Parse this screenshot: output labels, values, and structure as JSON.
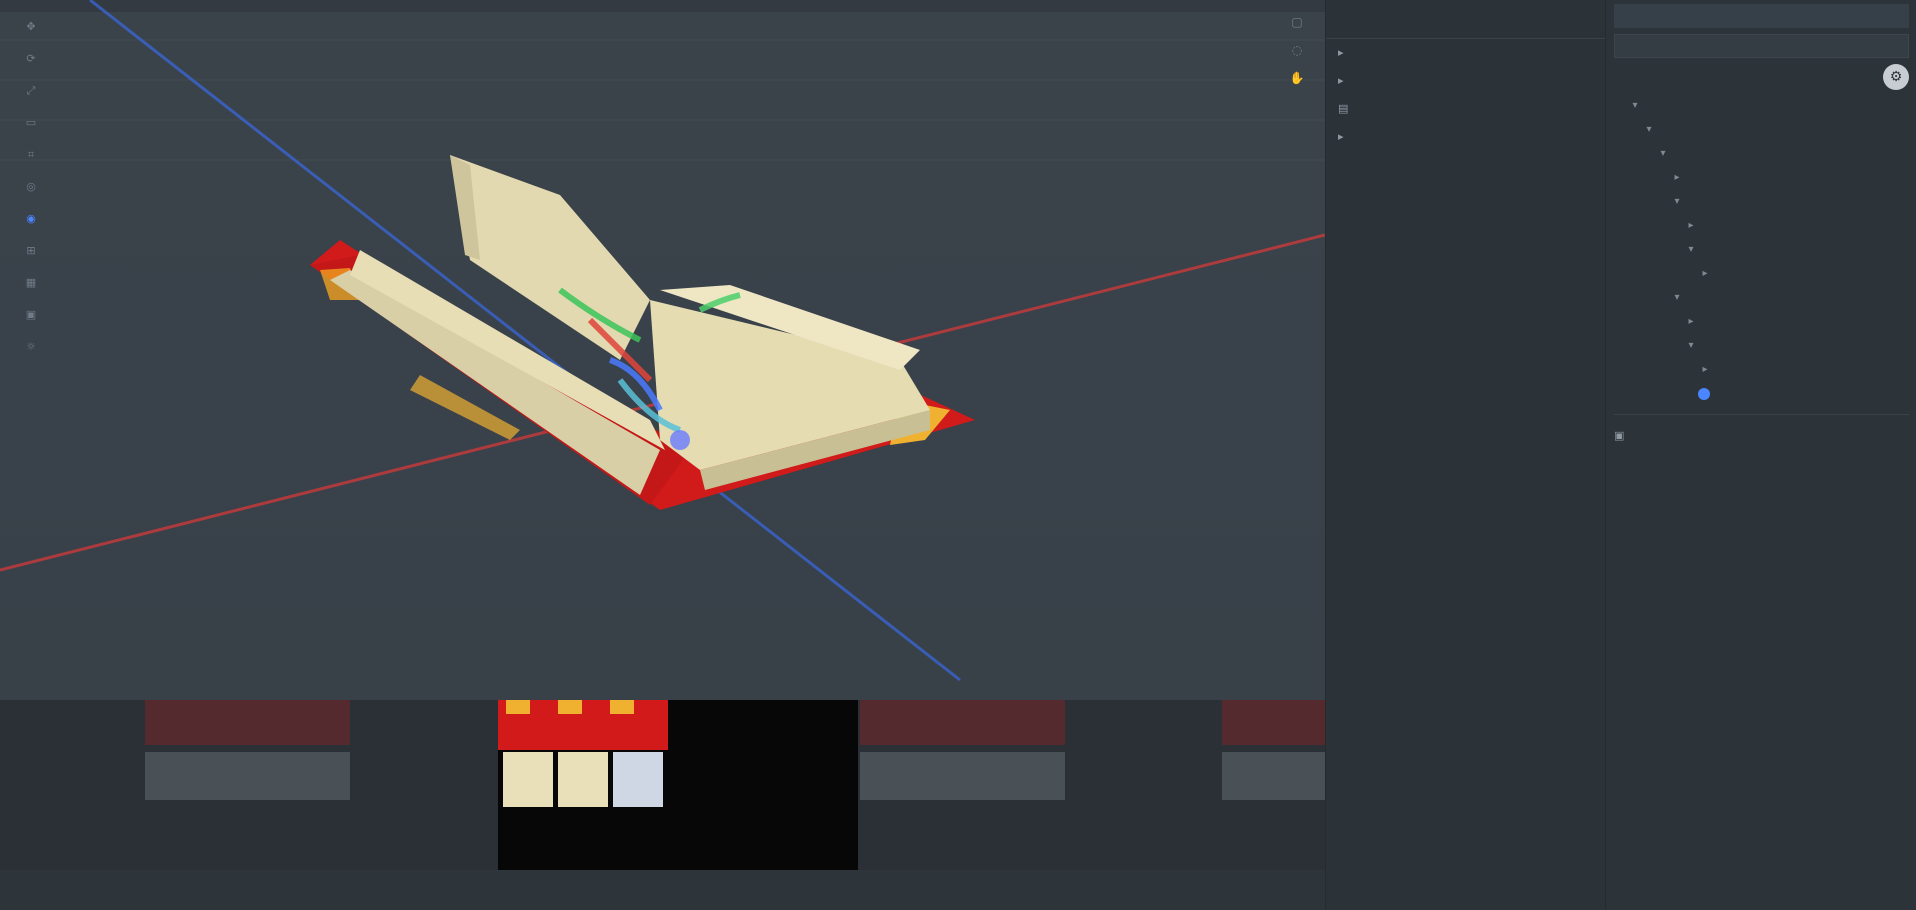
{
  "viewport": {
    "left_icons": [
      "move-icon",
      "rotate-icon",
      "scale-icon",
      "rect-icon",
      "frame-icon",
      "pivot-icon",
      "global-icon",
      "snap-icon",
      "grid-icon",
      "camera-icon",
      "light-icon",
      "audio-icon",
      "fx-icon"
    ],
    "right_icons": [
      "perspective-icon",
      "orbit-icon",
      "pan-icon"
    ]
  },
  "thumbnails": [
    {
      "name": "thumb-1",
      "selected": false
    },
    {
      "name": "thumb-2",
      "selected": true
    },
    {
      "name": "thumb-3",
      "selected": false
    },
    {
      "name": "thumb-4",
      "selected": false
    }
  ],
  "scene_panel": {
    "title": "",
    "rows": [
      "",
      "",
      "",
      ""
    ]
  },
  "hierarchy": {
    "tab": "",
    "filter_placeholder": "",
    "title": "",
    "items": [
      {
        "label": "",
        "depth": 1
      },
      {
        "label": "",
        "depth": 2
      },
      {
        "label": "",
        "depth": 3
      },
      {
        "label": "",
        "depth": 4
      },
      {
        "label": "",
        "depth": 4
      },
      {
        "label": "",
        "depth": 5
      },
      {
        "label": "",
        "depth": 5
      },
      {
        "label": "",
        "depth": 6
      },
      {
        "label": "",
        "depth": 4
      },
      {
        "label": "",
        "depth": 5
      },
      {
        "label": "",
        "depth": 5
      },
      {
        "label": "",
        "depth": 6
      },
      {
        "label": "",
        "depth": 6
      }
    ],
    "footer": ""
  },
  "colors": {
    "accent": "#4b86ff",
    "axis_x": "#c23b3b",
    "axis_z": "#3a63c7",
    "book_cover": "#d11a1a",
    "book_page": "#e9dfb8"
  }
}
